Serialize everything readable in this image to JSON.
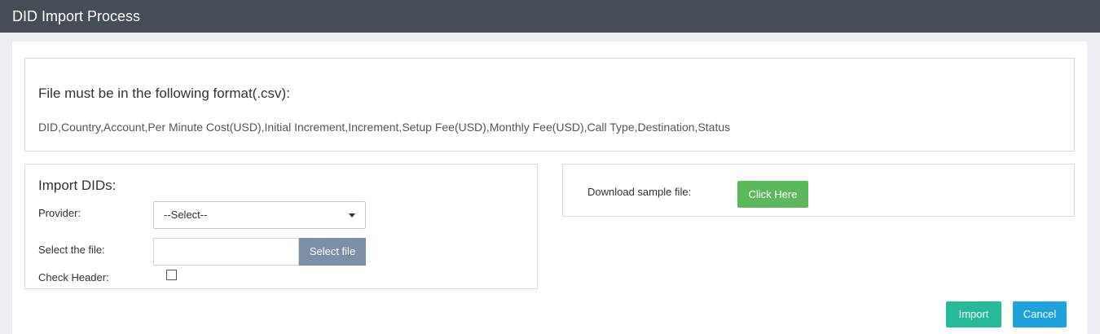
{
  "header": {
    "title": "DID Import Process"
  },
  "format": {
    "title": "File must be in the following format(.csv):",
    "columns": "DID,Country,Account,Per Minute Cost(USD),Initial Increment,Increment,Setup Fee(USD),Monthly Fee(USD),Call Type,Destination,Status"
  },
  "import": {
    "title": "Import DIDs:",
    "provider_label": "Provider:",
    "provider_value": "--Select--",
    "file_label": "Select the file:",
    "file_button": "Select file",
    "file_value": "",
    "check_header_label": "Check Header:",
    "check_header_checked": false
  },
  "download": {
    "label": "Download sample file:",
    "button": "Click Here"
  },
  "actions": {
    "import": "Import",
    "cancel": "Cancel"
  },
  "colors": {
    "header_bg": "#474d57",
    "click_here": "#5cb85c",
    "import": "#26b99a",
    "cancel": "#1ea1dc",
    "select_file": "#7d8fa6"
  }
}
